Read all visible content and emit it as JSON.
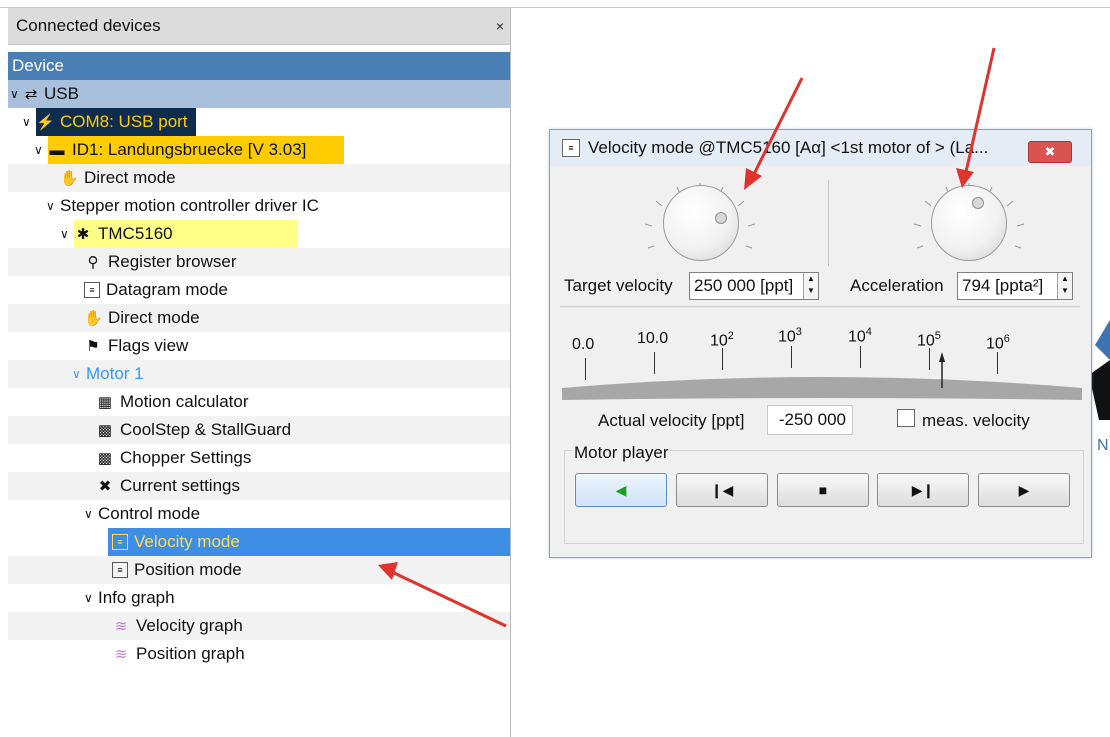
{
  "panel": {
    "title": "Connected devices",
    "close": "×",
    "header": "Device"
  },
  "tree": [
    {
      "label": "USB"
    },
    {
      "label": "COM8: USB port"
    },
    {
      "label": "ID1: Landungsbruecke [V 3.03]"
    },
    {
      "label": "Direct mode"
    },
    {
      "label": "Stepper motion controller driver IC"
    },
    {
      "label": "TMC5160"
    },
    {
      "label": "Register browser"
    },
    {
      "label": "Datagram mode"
    },
    {
      "label": "Direct mode"
    },
    {
      "label": "Flags view"
    },
    {
      "label": "Motor 1"
    },
    {
      "label": "Motion calculator"
    },
    {
      "label": "CoolStep & StallGuard"
    },
    {
      "label": "Chopper Settings"
    },
    {
      "label": "Current settings"
    },
    {
      "label": "Control mode"
    },
    {
      "label": "Velocity mode"
    },
    {
      "label": "Position mode"
    },
    {
      "label": "Info graph"
    },
    {
      "label": "Velocity graph"
    },
    {
      "label": "Position graph"
    }
  ],
  "dialog": {
    "title": "Velocity mode @TMC5160 [Aα] <1st motor of > (La...",
    "target_label": "Target velocity",
    "target_value": "250 000 [ppt]",
    "accel_label": "Acceleration",
    "accel_value": "794 [ppta²]",
    "scale": [
      "0.0",
      "10.0",
      "10",
      "2",
      "10",
      "3",
      "10",
      "4",
      "10",
      "5",
      "10",
      "6"
    ],
    "actual_label": "Actual velocity [ppt]",
    "actual_value": "-250 000",
    "meas_label": "meas. velocity",
    "player_title": "Motor player"
  },
  "colors": {
    "device_header": "#4a7fb5",
    "com_row": "#0e2c4e",
    "id_row": "#ffcc00",
    "tmc_row": "#ffff88",
    "selected": "#3e8ee6",
    "accent_text": "#3399ff",
    "arrow": "#e0332e"
  },
  "icons": [
    "usb-icon",
    "plug-icon",
    "board-icon",
    "hand-icon",
    "chip-icon",
    "search-icon",
    "datagram-icon",
    "flag-icon",
    "calculator-icon",
    "chart-bars-icon",
    "tools-icon",
    "graph-icon"
  ]
}
